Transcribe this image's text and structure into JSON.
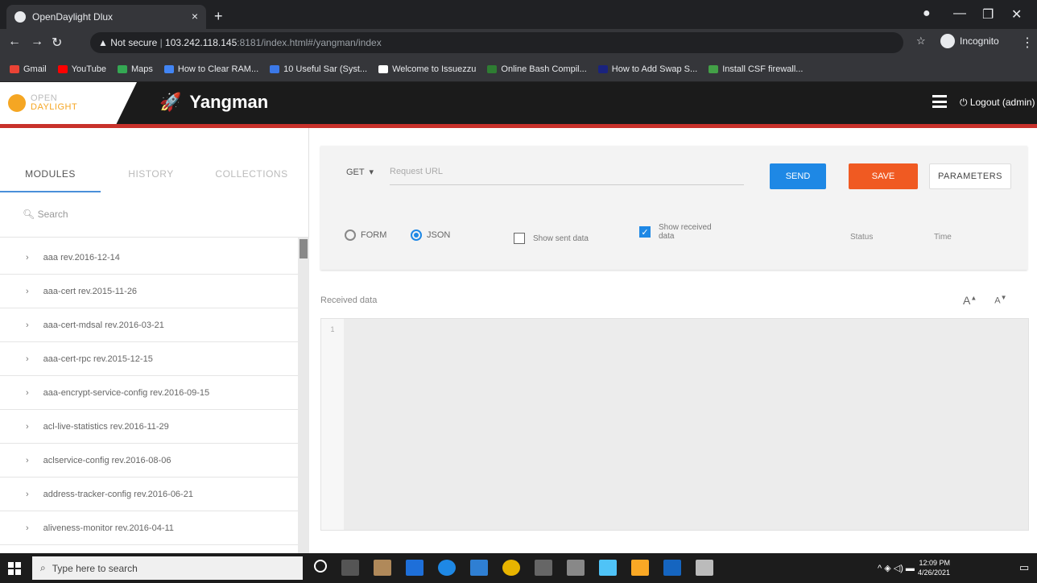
{
  "browser": {
    "tab_title": "OpenDaylight Dlux",
    "tab_close": "×",
    "new_tab": "+",
    "address_prefix": "Not secure",
    "address_host": "103.242.118.145",
    "address_path": ":8181/index.html#/yangman/index",
    "incognito_label": "Incognito",
    "bookmarks": [
      "Gmail",
      "YouTube",
      "Maps",
      "How to Clear RAM...",
      "10 Useful Sar (Syst...",
      "Welcome to Issuezzu",
      "Online Bash Compil...",
      "How to Add Swap S...",
      "Install CSF firewall..."
    ]
  },
  "header": {
    "logo_line1": "OPEN",
    "logo_line2": "DAYLIGHT",
    "app_name": "Yangman",
    "logout": "Logout (admin)"
  },
  "sidebar": {
    "tabs": [
      "MODULES",
      "HISTORY",
      "COLLECTIONS"
    ],
    "search_placeholder": "Search",
    "modules": [
      "aaa rev.2016-12-14",
      "aaa-cert rev.2015-11-26",
      "aaa-cert-mdsal rev.2016-03-21",
      "aaa-cert-rpc rev.2015-12-15",
      "aaa-encrypt-service-config rev.2016-09-15",
      "acl-live-statistics rev.2016-11-29",
      "aclservice-config rev.2016-08-06",
      "address-tracker-config rev.2016-06-21",
      "aliveness-monitor rev.2016-04-11"
    ]
  },
  "request": {
    "method": "GET",
    "url_placeholder": "Request URL",
    "send": "SEND",
    "save": "SAVE",
    "parameters": "PARAMETERS",
    "form_label": "FORM",
    "json_label": "JSON",
    "show_sent": "Show sent data",
    "show_received": "Show received data",
    "status_label": "Status",
    "time_label": "Time"
  },
  "received": {
    "label": "Received data",
    "line_number": "1",
    "font_increase": "A",
    "font_decrease": "A"
  },
  "taskbar": {
    "search_placeholder": "Type here to search",
    "time": "12:09 PM",
    "date": "4/26/2021"
  },
  "colors": {
    "accent_blue": "#1e88e5",
    "save_orange": "#f05a22",
    "header_red": "#c8312b"
  }
}
